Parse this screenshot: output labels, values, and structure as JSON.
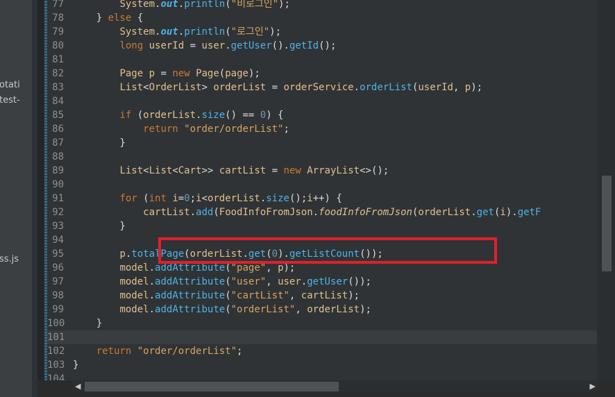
{
  "sidebar": {
    "fragments": [
      "otati",
      "test-",
      "ss.js"
    ]
  },
  "colors": {
    "keyword": "#cc7832",
    "string": "#d9a35f",
    "method": "#4fb3e6",
    "type": "#e2c08d",
    "highlight_box": "#e0202a"
  },
  "editor": {
    "lines": [
      {
        "n": "77",
        "t": "        System.out.println(\"비로그인\");"
      },
      {
        "n": "78",
        "t": "    } else {"
      },
      {
        "n": "79",
        "t": "        System.out.println(\"로그인\");"
      },
      {
        "n": "80",
        "t": "        long userId = user.getUser().getId();"
      },
      {
        "n": "81",
        "t": ""
      },
      {
        "n": "82",
        "t": "        Page p = new Page(page);"
      },
      {
        "n": "83",
        "t": "        List<OrderList> orderList = orderService.orderList(userId, p);"
      },
      {
        "n": "84",
        "t": ""
      },
      {
        "n": "85",
        "t": "        if (orderList.size() == 0) {"
      },
      {
        "n": "86",
        "t": "            return \"order/orderList\";"
      },
      {
        "n": "87",
        "t": "        }"
      },
      {
        "n": "88",
        "t": ""
      },
      {
        "n": "89",
        "t": "        List<List<Cart>> cartList = new ArrayList<>();"
      },
      {
        "n": "90",
        "t": ""
      },
      {
        "n": "91",
        "t": "        for (int i=0;i<orderList.size();i++) {"
      },
      {
        "n": "92",
        "t": "            cartList.add(FoodInfoFromJson.foodInfoFromJson(orderList.get(i).getF"
      },
      {
        "n": "93",
        "t": "        }"
      },
      {
        "n": "94",
        "t": ""
      },
      {
        "n": "95",
        "t": "        p.totalPage(orderList.get(0).getListCount());"
      },
      {
        "n": "96",
        "t": "        model.addAttribute(\"page\", p);"
      },
      {
        "n": "97",
        "t": "        model.addAttribute(\"user\", user.getUser());"
      },
      {
        "n": "98",
        "t": "        model.addAttribute(\"cartList\", cartList);"
      },
      {
        "n": "99",
        "t": "        model.addAttribute(\"orderList\", orderList);"
      },
      {
        "n": "100",
        "t": "    }"
      },
      {
        "n": "101",
        "t": ""
      },
      {
        "n": "102",
        "t": "    return \"order/orderList\";"
      },
      {
        "n": "103",
        "t": "}"
      },
      {
        "n": "104",
        "t": ""
      }
    ]
  }
}
